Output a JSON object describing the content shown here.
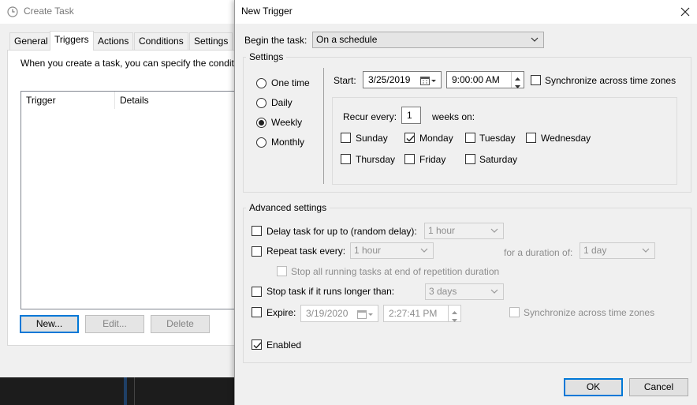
{
  "background_window": {
    "title": "Create Task",
    "tabs": [
      "General",
      "Triggers",
      "Actions",
      "Conditions",
      "Settings"
    ],
    "active_tab": "Triggers",
    "description": "When you create a task, you can specify the conditi",
    "columns": [
      "Trigger",
      "Details"
    ],
    "buttons": {
      "new": "New...",
      "edit": "Edit...",
      "delete": "Delete"
    }
  },
  "dialog": {
    "title": "New Trigger",
    "begin_label": "Begin the task:",
    "begin_value": "On a schedule",
    "settings": {
      "title": "Settings",
      "radios": [
        "One time",
        "Daily",
        "Weekly",
        "Monthly"
      ],
      "selected": "Weekly",
      "start_label": "Start:",
      "start_date": "3/25/2019",
      "start_time": "9:00:00 AM",
      "sync_label": "Synchronize across time zones",
      "recur_label": "Recur every:",
      "recur_value": "1",
      "weeks_on": "weeks on:",
      "days": [
        "Sunday",
        "Monday",
        "Tuesday",
        "Wednesday",
        "Thursday",
        "Friday",
        "Saturday"
      ],
      "checked_days": [
        "Monday"
      ]
    },
    "advanced": {
      "title": "Advanced settings",
      "delay_label": "Delay task for up to (random delay):",
      "delay_value": "1 hour",
      "repeat_label": "Repeat task every:",
      "repeat_value": "1 hour",
      "duration_label": "for a duration of:",
      "duration_value": "1 day",
      "stop_running_label": "Stop all running tasks at end of repetition duration",
      "stop_longer_label": "Stop task if it runs longer than:",
      "stop_longer_value": "3 days",
      "expire_label": "Expire:",
      "expire_date": "3/19/2020",
      "expire_time": "2:27:41 PM",
      "expire_sync_label": "Synchronize across time zones",
      "enabled_label": "Enabled",
      "enabled_checked": true
    },
    "buttons": {
      "ok": "OK",
      "cancel": "Cancel"
    }
  },
  "colors": {
    "accent": "#0078d7",
    "background": "#f0f0f0",
    "taskbar": "#1c1c1c"
  }
}
